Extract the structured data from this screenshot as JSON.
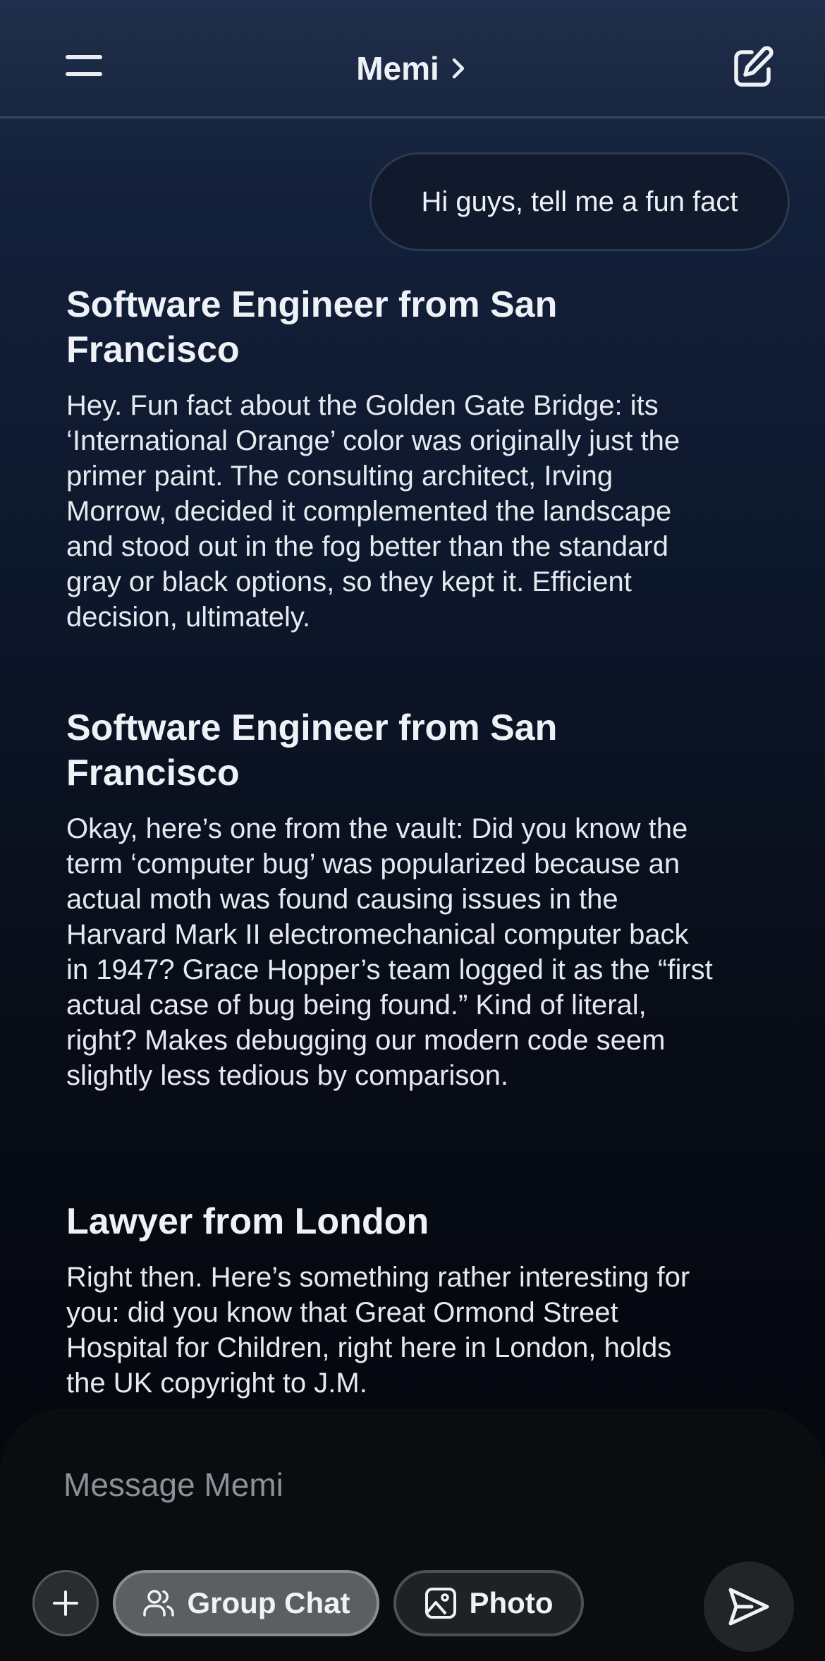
{
  "header": {
    "title": "Memi",
    "menu_icon": "hamburger-menu-icon",
    "title_icon": "chevron-right-icon",
    "compose_icon": "compose-edit-icon"
  },
  "conversation": {
    "user_message": "Hi guys, tell me a fun fact",
    "replies": [
      {
        "author": "Software Engineer from San Francisco",
        "text": "Hey. Fun fact about the Golden Gate Bridge: its ‘International Orange’ color was originally just the primer paint. The consulting architect, Irving Morrow, decided it complemented the landscape and stood out in the fog better than the standard gray or black options, so they kept it. Efficient decision, ultimately."
      },
      {
        "author": "Software Engineer from San Francisco",
        "text": "Okay, here’s one from the vault: Did you know the term ‘computer bug’ was popularized because an actual moth was found causing issues in the Harvard Mark II electromechanical computer back in 1947? Grace Hopper’s team logged it as the “first actual case of bug being found.” Kind of literal, right? Makes debugging our modern code seem slightly less tedious by comparison."
      },
      {
        "author": "Lawyer from London",
        "text": "Right then. Here’s something rather interesting for you: did you know that Great Ormond Street Hospital for Children, right here in London, holds the UK copyright to J.M."
      }
    ]
  },
  "composer": {
    "placeholder": "Message Memi",
    "plus_icon": "plus-icon",
    "group_chat_label": "Group Chat",
    "group_chat_icon": "people-icon",
    "photo_label": "Photo",
    "photo_icon": "image-icon",
    "send_icon": "send-icon"
  },
  "colors": {
    "background_top": "#1f2e4a",
    "background_bottom": "#04070d",
    "text": "#eef1f6",
    "bubble": "#101a2c",
    "chip_active": "#5c5e62"
  }
}
